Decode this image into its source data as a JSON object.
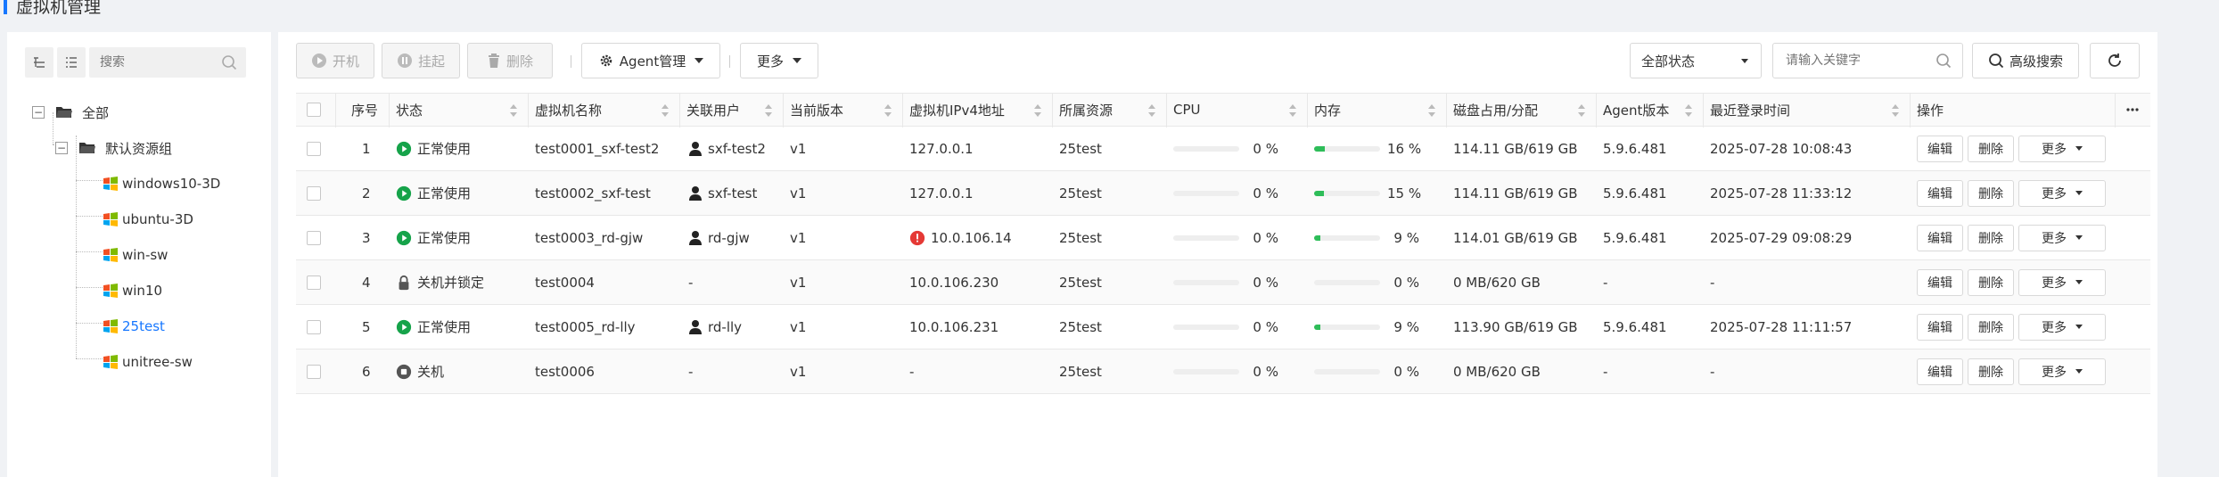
{
  "page": {
    "title": "虚拟机管理"
  },
  "sidebar": {
    "search_placeholder": "搜索",
    "tree": {
      "root": "全部",
      "group": "默认资源组",
      "items": [
        "windows10-3D",
        "ubuntu-3D",
        "win-sw",
        "win10",
        "25test",
        "unitree-sw"
      ],
      "active_item": "25test"
    }
  },
  "toolbar": {
    "power_on": "开机",
    "suspend": "挂起",
    "delete": "删除",
    "agent_manage": "Agent管理",
    "more": "更多",
    "status_filter": "全部状态",
    "search_placeholder": "请输入关键字",
    "advanced_search": "高级搜索"
  },
  "table": {
    "columns": [
      "序号",
      "状态",
      "虚拟机名称",
      "关联用户",
      "当前版本",
      "虚拟机IPv4地址",
      "所属资源",
      "CPU",
      "内存",
      "磁盘占用/分配",
      "Agent版本",
      "最近登录时间",
      "操作"
    ],
    "action_labels": {
      "edit": "编辑",
      "delete": "删除",
      "more": "更多"
    },
    "rows": [
      {
        "index": "1",
        "status": "正常使用",
        "status_type": "running",
        "name": "test0001_sxf-test2",
        "user": "sxf-test2",
        "version": "v1",
        "ip": "127.0.0.1",
        "ip_warning": false,
        "resource": "25test",
        "cpu": "0 %",
        "cpu_fraction": 0,
        "mem": "16 %",
        "mem_fraction": 0.16,
        "disk": "114.11 GB/619 GB",
        "agent": "5.9.6.481",
        "last_login": "2025-07-28 10:08:43"
      },
      {
        "index": "2",
        "status": "正常使用",
        "status_type": "running",
        "name": "test0002_sxf-test",
        "user": "sxf-test",
        "version": "v1",
        "ip": "127.0.0.1",
        "ip_warning": false,
        "resource": "25test",
        "cpu": "0 %",
        "cpu_fraction": 0,
        "mem": "15 %",
        "mem_fraction": 0.15,
        "disk": "114.11 GB/619 GB",
        "agent": "5.9.6.481",
        "last_login": "2025-07-28 11:33:12"
      },
      {
        "index": "3",
        "status": "正常使用",
        "status_type": "running",
        "name": "test0003_rd-gjw",
        "user": "rd-gjw",
        "version": "v1",
        "ip": "10.0.106.14",
        "ip_warning": true,
        "resource": "25test",
        "cpu": "0 %",
        "cpu_fraction": 0,
        "mem": "9 %",
        "mem_fraction": 0.09,
        "disk": "114.01 GB/619 GB",
        "agent": "5.9.6.481",
        "last_login": "2025-07-29 09:08:29"
      },
      {
        "index": "4",
        "status": "关机并锁定",
        "status_type": "locked",
        "name": "test0004",
        "user": "-",
        "version": "v1",
        "ip": "10.0.106.230",
        "ip_warning": false,
        "resource": "25test",
        "cpu": "0 %",
        "cpu_fraction": 0,
        "mem": "0 %",
        "mem_fraction": 0,
        "disk": "0 MB/620 GB",
        "agent": "-",
        "last_login": "-"
      },
      {
        "index": "5",
        "status": "正常使用",
        "status_type": "running",
        "name": "test0005_rd-lly",
        "user": "rd-lly",
        "version": "v1",
        "ip": "10.0.106.231",
        "ip_warning": false,
        "resource": "25test",
        "cpu": "0 %",
        "cpu_fraction": 0,
        "mem": "9 %",
        "mem_fraction": 0.09,
        "disk": "113.90 GB/619 GB",
        "agent": "5.9.6.481",
        "last_login": "2025-07-28 11:11:57"
      },
      {
        "index": "6",
        "status": "关机",
        "status_type": "off",
        "name": "test0006",
        "user": "-",
        "version": "v1",
        "ip": "-",
        "ip_warning": false,
        "resource": "25test",
        "cpu": "0 %",
        "cpu_fraction": 0,
        "mem": "0 %",
        "mem_fraction": 0,
        "disk": "0 MB/620 GB",
        "agent": "-",
        "last_login": "-"
      }
    ]
  },
  "colors": {
    "accent": "#1677ff",
    "running": "#16a34a",
    "warning": "#e53935",
    "bar_fill": "#2ebd59",
    "off": "#555555"
  }
}
